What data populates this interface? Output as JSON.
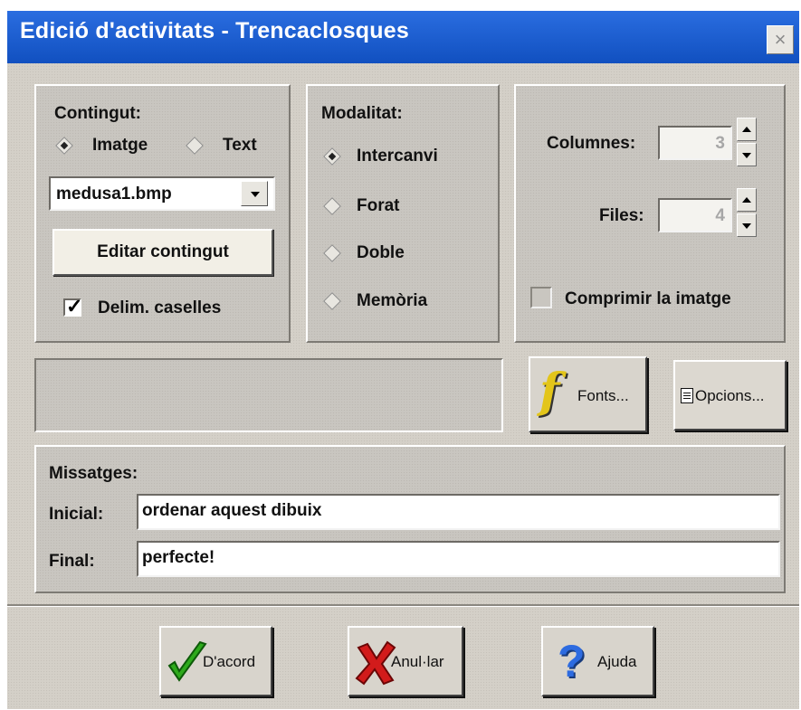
{
  "window": {
    "title": "Edició d'activitats - Trencaclosques",
    "close_label": "×"
  },
  "contingut": {
    "heading": "Contingut:",
    "options": [
      {
        "label": "Imatge",
        "selected": true
      },
      {
        "label": "Text",
        "selected": false
      }
    ],
    "file_value": "medusa1.bmp",
    "edit_button": "Editar contingut",
    "checkbox_label": "Delim. caselles",
    "checkbox_checked": true
  },
  "modalitat": {
    "heading": "Modalitat:",
    "options": [
      {
        "label": "Intercanvi",
        "selected": true
      },
      {
        "label": "Forat",
        "selected": false
      },
      {
        "label": "Doble",
        "selected": false
      },
      {
        "label": "Memòria",
        "selected": false
      }
    ]
  },
  "grid": {
    "columns_label": "Columnes:",
    "columns_value": "3",
    "rows_label": "Files:",
    "rows_value": "4",
    "compress_label": "Comprimir la imatge",
    "compress_checked": false
  },
  "toolbar": {
    "fonts_label": "Fonts...",
    "options_label": "Opcions..."
  },
  "messages": {
    "heading": "Missatges:",
    "initial_label": "Inicial:",
    "initial_value": "ordenar aquest dibuix",
    "final_label": "Final:",
    "final_value": "perfecte!"
  },
  "footer": {
    "ok_label": "D'acord",
    "cancel_label": "Anul·lar",
    "help_label": "Ajuda"
  },
  "colors": {
    "titlebar": "#1a5fcf",
    "ok_check": "#2eaa1c",
    "cancel_x": "#d21b1b",
    "help_q": "#2d6be0",
    "fonts_f": "#e3c51a"
  }
}
